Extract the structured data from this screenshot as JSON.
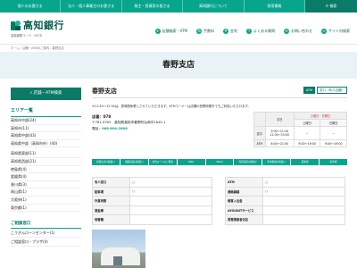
{
  "topnav": {
    "items": [
      "個人のお客さま",
      "法人・個人事業主のお客さま",
      "株主・投資家の皆さま",
      "高知銀行について",
      "採用情報"
    ],
    "search": "検索"
  },
  "header": {
    "logo_text": "高知銀行",
    "bank_code": "金融機関コード：0578",
    "nav": [
      {
        "icon": "⌖",
        "label": "店舗検索・ATM"
      },
      {
        "icon": "%",
        "label": "手数料"
      },
      {
        "icon": "¥",
        "label": "金利"
      },
      {
        "icon": "?",
        "label": "よくある質問"
      },
      {
        "icon": "✉",
        "label": "お問い合わせ"
      },
      {
        "icon": "≡",
        "label": "サイト内検索"
      }
    ]
  },
  "breadcrumb": "ホーム › 店舗・ATMのご案内 › 春野支店",
  "page_title": "春野支店",
  "sidebar": {
    "search_btn": "店舗・ATM検索",
    "area_heading": "エリア一覧",
    "areas": [
      "高知市中部(24)",
      "高知市(11)",
      "高知県中部(43)",
      "高知県中部（高知市外）(40)",
      "高知県東部(11)",
      "高知県西部(21)",
      "徳島県(4)",
      "愛媛県(4)",
      "香川県(3)",
      "岡山県(1)",
      "大阪府(1)",
      "東京都(1)"
    ],
    "consult_heading": "ご相談窓口",
    "consult": [
      "こうぎんローンセンター(1)",
      "ご相談窓口・プラザ(4)"
    ]
  },
  "main": {
    "title": "春野支店",
    "tags": [
      "ATM",
      "窓口（有人店舗）"
    ],
    "notice": "※11:30～12:30は、昼時間休業とさせていただきます。ATMコーナーは店舗の営業時間外でもご利用いただけます。",
    "store_label": "店番：078",
    "address": "〒781-0302　高知県高知市春野町弘岡中1645-1",
    "tel_label": "電話：",
    "tel": "088-894-2808",
    "hours": {
      "col_weekday": "平日",
      "col_holiday": "土曜日・日曜日",
      "col_sat": "土曜日",
      "col_sun": "日曜日",
      "row_window": "窓口",
      "window_weekday": "9:00～11:30\n12:30～15:00",
      "window_sat": "－",
      "window_sun": "－",
      "row_atm": "ATM",
      "atm_weekday": "8:00～21:00",
      "atm_sat": "9:00～19:00",
      "atm_sun": "9:00～19:00"
    },
    "services": [
      "投資信託の取扱い",
      "保険商品の取扱い",
      "住宅ローンのご相談",
      "NISA",
      "iDeCo",
      "外貨両替の取扱い",
      "年金相談の取扱い",
      "貸金庫",
      "駐車場"
    ],
    "facilities_left": [
      {
        "k": "有人窓口",
        "v": "○"
      },
      {
        "k": "駐車場",
        "v": "○"
      },
      {
        "k": "外貨両替",
        "v": ""
      },
      {
        "k": "貸金庫",
        "v": ""
      },
      {
        "k": "両替機",
        "v": ""
      }
    ],
    "facilities_right": [
      {
        "k": "ATM",
        "v": "○"
      },
      {
        "k": "通帳繰越",
        "v": "○"
      },
      {
        "k": "硬貨入出金",
        "v": ""
      },
      {
        "k": "AYOUNITサービス",
        "v": ""
      },
      {
        "k": "視覚障害者対応",
        "v": ""
      }
    ]
  }
}
